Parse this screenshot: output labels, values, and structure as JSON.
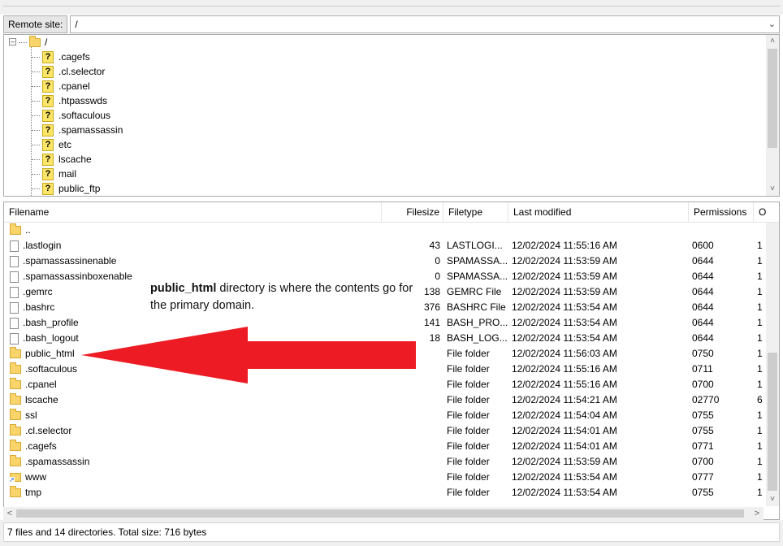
{
  "remote_site": {
    "label": "Remote site:",
    "path": "/"
  },
  "tree": {
    "root": "/",
    "children": [
      ".cagefs",
      ".cl.selector",
      ".cpanel",
      ".htpasswds",
      ".softaculous",
      ".spamassassin",
      "etc",
      "lscache",
      "mail",
      "public_ftp"
    ]
  },
  "file_list": {
    "columns": {
      "filename": "Filename",
      "filesize": "Filesize",
      "filetype": "Filetype",
      "modified": "Last modified",
      "permissions": "Permissions",
      "owner": "O"
    },
    "rows": [
      {
        "icon": "folder",
        "name": "..",
        "size": "",
        "type": "",
        "modified": "",
        "perm": "",
        "owner": ""
      },
      {
        "icon": "file",
        "name": ".lastlogin",
        "size": "43",
        "type": "LASTLOGI...",
        "modified": "12/02/2024 11:55:16 AM",
        "perm": "0600",
        "owner": "1"
      },
      {
        "icon": "file",
        "name": ".spamassassinenable",
        "size": "0",
        "type": "SPAMASSA...",
        "modified": "12/02/2024 11:53:59 AM",
        "perm": "0644",
        "owner": "1"
      },
      {
        "icon": "file",
        "name": ".spamassassinboxenable",
        "size": "0",
        "type": "SPAMASSA...",
        "modified": "12/02/2024 11:53:59 AM",
        "perm": "0644",
        "owner": "1"
      },
      {
        "icon": "file",
        "name": ".gemrc",
        "size": "138",
        "type": "GEMRC File",
        "modified": "12/02/2024 11:53:59 AM",
        "perm": "0644",
        "owner": "1"
      },
      {
        "icon": "file",
        "name": ".bashrc",
        "size": "376",
        "type": "BASHRC File",
        "modified": "12/02/2024 11:53:54 AM",
        "perm": "0644",
        "owner": "1"
      },
      {
        "icon": "file",
        "name": ".bash_profile",
        "size": "141",
        "type": "BASH_PRO...",
        "modified": "12/02/2024 11:53:54 AM",
        "perm": "0644",
        "owner": "1"
      },
      {
        "icon": "file",
        "name": ".bash_logout",
        "size": "18",
        "type": "BASH_LOG...",
        "modified": "12/02/2024 11:53:54 AM",
        "perm": "0644",
        "owner": "1"
      },
      {
        "icon": "folder",
        "name": "public_html",
        "size": "",
        "type": "File folder",
        "modified": "12/02/2024 11:56:03 AM",
        "perm": "0750",
        "owner": "1"
      },
      {
        "icon": "folder",
        "name": ".softaculous",
        "size": "",
        "type": "File folder",
        "modified": "12/02/2024 11:55:16 AM",
        "perm": "0711",
        "owner": "1"
      },
      {
        "icon": "folder",
        "name": ".cpanel",
        "size": "",
        "type": "File folder",
        "modified": "12/02/2024 11:55:16 AM",
        "perm": "0700",
        "owner": "1"
      },
      {
        "icon": "folder",
        "name": "lscache",
        "size": "",
        "type": "File folder",
        "modified": "12/02/2024 11:54:21 AM",
        "perm": "02770",
        "owner": "6"
      },
      {
        "icon": "folder",
        "name": "ssl",
        "size": "",
        "type": "File folder",
        "modified": "12/02/2024 11:54:04 AM",
        "perm": "0755",
        "owner": "1"
      },
      {
        "icon": "folder",
        "name": ".cl.selector",
        "size": "",
        "type": "File folder",
        "modified": "12/02/2024 11:54:01 AM",
        "perm": "0755",
        "owner": "1"
      },
      {
        "icon": "folder",
        "name": ".cagefs",
        "size": "",
        "type": "File folder",
        "modified": "12/02/2024 11:54:01 AM",
        "perm": "0771",
        "owner": "1"
      },
      {
        "icon": "folder",
        "name": ".spamassassin",
        "size": "",
        "type": "File folder",
        "modified": "12/02/2024 11:53:59 AM",
        "perm": "0700",
        "owner": "1"
      },
      {
        "icon": "link-folder",
        "name": "www",
        "size": "",
        "type": "File folder",
        "modified": "12/02/2024 11:53:54 AM",
        "perm": "0777",
        "owner": "1"
      },
      {
        "icon": "folder",
        "name": "tmp",
        "size": "",
        "type": "File folder",
        "modified": "12/02/2024 11:53:54 AM",
        "perm": "0755",
        "owner": "1"
      }
    ]
  },
  "annotation": {
    "bold": "public_html",
    "text": " directory is where the contents go for the primary domain."
  },
  "status": "7 files and 14 directories. Total size: 716 bytes",
  "colors": {
    "arrow": "#ed1c24",
    "folder": "#f9d46b",
    "unknown_icon": "#fde567"
  },
  "icons": {
    "tree_expander": "minus-box-icon",
    "tree_child": "question-mark-icon",
    "dropdown": "chevron-down-icon",
    "scroll_up": "arrow-up-icon",
    "scroll_down": "arrow-down-icon",
    "scroll_left": "arrow-left-icon",
    "scroll_right": "arrow-right-icon"
  }
}
